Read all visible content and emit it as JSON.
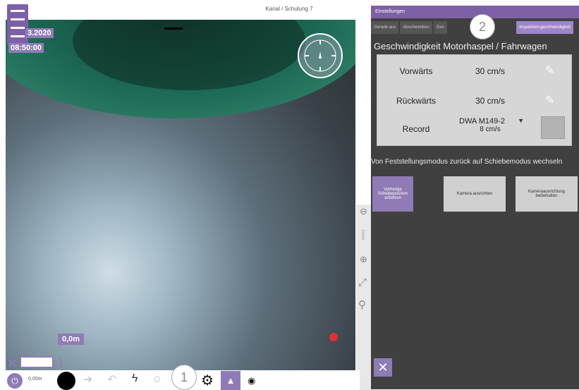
{
  "header": {
    "title": "Kanal / Schulung 7",
    "date_fragment": "3.2020",
    "time": "08:50:00"
  },
  "camera": {
    "distance_label": "0,0m"
  },
  "settings": {
    "strip_title": "Einstellungen",
    "tabs": [
      {
        "label": "Gerade aus"
      },
      {
        "label": "Abschwenken"
      },
      {
        "label": "Gen"
      },
      {
        "label": "Inspektionsgeschwindigkeit"
      }
    ],
    "speed_section_title": "Geschwindigkeit Motorhaspel / Fahrwagen",
    "rows": {
      "forward_label": "Vorwärts",
      "forward_value": "30 cm/s",
      "backward_label": "Rückwärts",
      "backward_value": "30 cm/s",
      "record_label": "Record",
      "record_select": "DWA M149-2",
      "record_value": "8 cm/s"
    },
    "mode_heading": "Von Feststellungsmodus zurück auf Schiebemodus wechseln",
    "mode_buttons": [
      {
        "label": "Vorherige Schiebeposition anfahren"
      },
      {
        "label": "Kamera ausrichten"
      },
      {
        "label": "Kameraausrichtung beibehalten"
      }
    ]
  },
  "side_tools": {
    "zoom_label": "Zoom"
  },
  "bottom": {
    "distance": "0,00m"
  },
  "annotations": {
    "marker_1": "1",
    "marker_2": "2"
  },
  "colors": {
    "accent": "#7d60a6",
    "panel": "#404040",
    "record_dot": "#e03030"
  }
}
